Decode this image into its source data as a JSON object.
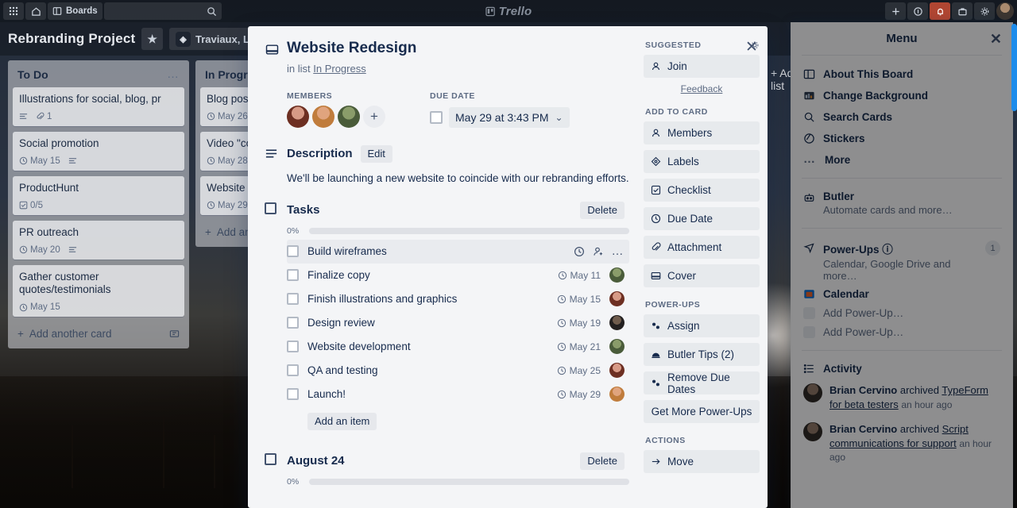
{
  "topnav": {
    "boards_label": "Boards",
    "search_placeholder": "",
    "logo_text": "Trello",
    "buttons": [
      {
        "name": "apps-grid-icon",
        "label": ""
      },
      {
        "name": "home-icon",
        "label": ""
      },
      {
        "name": "boards-button",
        "label": "Boards"
      }
    ],
    "right_buttons": [
      {
        "name": "add-icon",
        "label": "+"
      },
      {
        "name": "info-icon",
        "label": ""
      },
      {
        "name": "notifications-bell-icon",
        "label": ""
      },
      {
        "name": "briefcase-icon",
        "label": ""
      },
      {
        "name": "gear-icon",
        "label": ""
      }
    ]
  },
  "board_header": {
    "title": "Rebranding Project",
    "star_label": "★",
    "team_name": "Traviaux, LLC",
    "team_initial": "◈"
  },
  "lists": [
    {
      "title": "To Do",
      "menu": "…",
      "cards": [
        {
          "title": "Illustrations for social, blog, pr",
          "badges": [
            {
              "icon": "description-icon",
              "text": ""
            },
            {
              "icon": "attachment-icon",
              "text": "1"
            }
          ]
        },
        {
          "title": "Social promotion",
          "badges": [
            {
              "icon": "clock-icon",
              "text": "May 15"
            },
            {
              "icon": "description-icon",
              "text": ""
            }
          ]
        },
        {
          "title": "ProductHunt",
          "badges": [
            {
              "icon": "checklist-icon",
              "text": "0/5"
            }
          ]
        },
        {
          "title": "PR outreach",
          "badges": [
            {
              "icon": "clock-icon",
              "text": "May 20"
            },
            {
              "icon": "description-icon",
              "text": ""
            }
          ]
        },
        {
          "title": "Gather customer quotes/testimonials",
          "badges": [
            {
              "icon": "clock-icon",
              "text": "May 15"
            }
          ]
        }
      ],
      "add_card_label": "Add another card"
    },
    {
      "title": "In Progress",
      "menu": "…",
      "cards": [
        {
          "title": "Blog post",
          "badges": [
            {
              "icon": "clock-icon",
              "text": "May 26"
            }
          ]
        },
        {
          "title": "Video \"coming soon\"",
          "badges": [
            {
              "icon": "clock-icon",
              "text": "May 28"
            }
          ]
        },
        {
          "title": "Website Redesign",
          "badges": [
            {
              "icon": "clock-icon",
              "text": "May 29"
            }
          ]
        }
      ],
      "add_card_label": "Add another card"
    }
  ],
  "add_list_label": "+ Add another list",
  "card_modal": {
    "title": "Website Redesign",
    "in_list_prefix": "in list ",
    "in_list_name": "In Progress",
    "close_label": "✕",
    "members_label": "MEMBERS",
    "add_member_label": "+",
    "due_date_label": "DUE DATE",
    "due_date_value": "May 29 at 3:43 PM",
    "due_date_caret": "⌄",
    "description_label": "Description",
    "description_edit_label": "Edit",
    "description_text": "We'll be launching a new website to coincide with our rebranding efforts.",
    "checklists": [
      {
        "name": "Tasks",
        "delete_label": "Delete",
        "progress_percent": "0%",
        "progress_value": 0,
        "add_item_label": "Add an item",
        "items": [
          {
            "label": "Build wireframes",
            "date": "",
            "has_avatar": false,
            "hovered": true
          },
          {
            "label": "Finalize copy",
            "date": "May 11",
            "has_avatar": true,
            "hovered": false
          },
          {
            "label": "Finish illustrations and graphics",
            "date": "May 15",
            "has_avatar": true,
            "hovered": false
          },
          {
            "label": "Design review",
            "date": "May 19",
            "has_avatar": true,
            "hovered": false
          },
          {
            "label": "Website development",
            "date": "May 21",
            "has_avatar": true,
            "hovered": false
          },
          {
            "label": "QA and testing",
            "date": "May 25",
            "has_avatar": true,
            "hovered": false
          },
          {
            "label": "Launch!",
            "date": "May 29",
            "has_avatar": true,
            "hovered": false
          }
        ]
      },
      {
        "name": "August 24",
        "delete_label": "Delete",
        "progress_percent": "0%",
        "progress_value": 0,
        "add_item_label": "",
        "items": []
      }
    ],
    "sidebar": {
      "suggested_label": "SUGGESTED",
      "suggested_items": [
        {
          "label": "Join",
          "icon": "person-icon"
        }
      ],
      "feedback_label": "Feedback",
      "add_to_card_label": "ADD TO CARD",
      "add_to_card_items": [
        {
          "label": "Members",
          "icon": "person-icon"
        },
        {
          "label": "Labels",
          "icon": "label-icon"
        },
        {
          "label": "Checklist",
          "icon": "checklist-icon"
        },
        {
          "label": "Due Date",
          "icon": "clock-icon"
        },
        {
          "label": "Attachment",
          "icon": "attachment-icon"
        },
        {
          "label": "Cover",
          "icon": "cover-icon"
        }
      ],
      "power_ups_label": "POWER-UPS",
      "power_ups_items": [
        {
          "label": "Assign",
          "icon": "gear-icon"
        },
        {
          "label": "Butler Tips (2)",
          "icon": "butler-icon"
        },
        {
          "label": "Remove Due Dates",
          "icon": "gear-icon"
        },
        {
          "label": "Get More Power-Ups",
          "icon": ""
        }
      ],
      "actions_label": "ACTIONS",
      "actions_items": [
        {
          "label": "Move",
          "icon": "arrow-right-icon"
        }
      ]
    }
  },
  "menu_panel": {
    "title": "Menu",
    "close_label": "✕",
    "items": [
      {
        "label": "About This Board",
        "sub": "",
        "icon": "board-icon",
        "badge": ""
      },
      {
        "label": "Change Background",
        "sub": "",
        "icon": "background-icon",
        "badge": ""
      },
      {
        "label": "Search Cards",
        "sub": "",
        "icon": "search-icon",
        "badge": ""
      },
      {
        "label": "Stickers",
        "sub": "",
        "icon": "sticker-icon",
        "badge": ""
      },
      {
        "label": "More",
        "sub": "",
        "icon": "more-icon",
        "badge": ""
      }
    ],
    "groups": [
      {
        "label": "Butler",
        "sub": "Automate cards and more…",
        "icon": "butler-icon",
        "badge": ""
      },
      {
        "label": "Power-Ups ⓘ",
        "sub": "Calendar, Google Drive and more…",
        "icon": "powerup-icon",
        "badge": "1"
      }
    ],
    "powerups": [
      {
        "label": "Calendar",
        "icon": "calendar-icon"
      },
      {
        "label": "Add Power-Up…",
        "icon": "placeholder-icon"
      },
      {
        "label": "Add Power-Up…",
        "icon": "placeholder-icon"
      }
    ],
    "activity_label": "Activity",
    "activity": [
      {
        "user": "Brian Cervino",
        "action": " archived ",
        "target": "TypeForm for beta testers",
        "time": "an hour ago"
      },
      {
        "user": "Brian Cervino",
        "action": " archived ",
        "target": "Script communications for support",
        "time": "an hour ago"
      }
    ]
  },
  "colors": {
    "accent": "#0079bf",
    "modal_bg": "#f4f5f7",
    "text": "#172b4d",
    "muted": "#5e6c84",
    "danger": "#b04632",
    "scrollbar": "#1d8ceb"
  }
}
